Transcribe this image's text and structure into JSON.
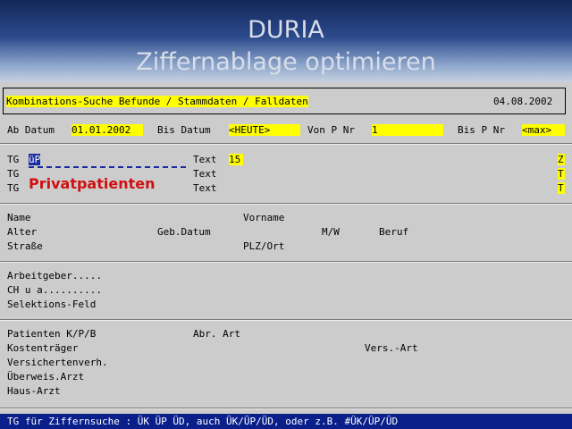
{
  "header": {
    "title": "DURIA",
    "subtitle": "Ziffernablage optimieren"
  },
  "search_bar": {
    "title": "Kombinations-Suche Befunde / Stammdaten / Falldaten",
    "date": "04.08.2002"
  },
  "date_row": {
    "ab_label": "Ab Datum",
    "ab_value": "01.01.2002",
    "bis_label": "Bis Datum",
    "bis_value": "<HEUTE>",
    "von_label": "Von P Nr",
    "von_value": "1",
    "bisp_label": "Bis P Nr",
    "bisp_value": "<max>"
  },
  "tg": {
    "label": "TG",
    "input_value": "üP",
    "text_label": "Text",
    "text_value": "15",
    "privat": "Privatpatienten",
    "flags": [
      "Z",
      "T",
      "T"
    ]
  },
  "patient": {
    "name": "Name",
    "vorname": "Vorname",
    "alter": "Alter",
    "geb": "Geb.Datum",
    "mw": "M/W",
    "beruf": "Beruf",
    "strasse": "Straße",
    "plz": "PLZ/Ort"
  },
  "employer": {
    "arbeitgeber": "Arbeitgeber.....",
    "ch": "CH u a..........",
    "selektion": "Selektions-Feld"
  },
  "billing": {
    "patienten": "Patienten K/P/B",
    "abr": "Abr. Art",
    "kosten": "Kostenträger",
    "vers": "Vers.-Art",
    "versverh": "Versichertenverh.",
    "ueberweis": "Überweis.Arzt",
    "haus": "Haus-Arzt"
  },
  "status_bar": "TG für Ziffernsuche : ÜK ÜP ÜD, auch ÜK/ÜP/ÜD, oder z.B. #ÜK/ÜP/ÜD"
}
